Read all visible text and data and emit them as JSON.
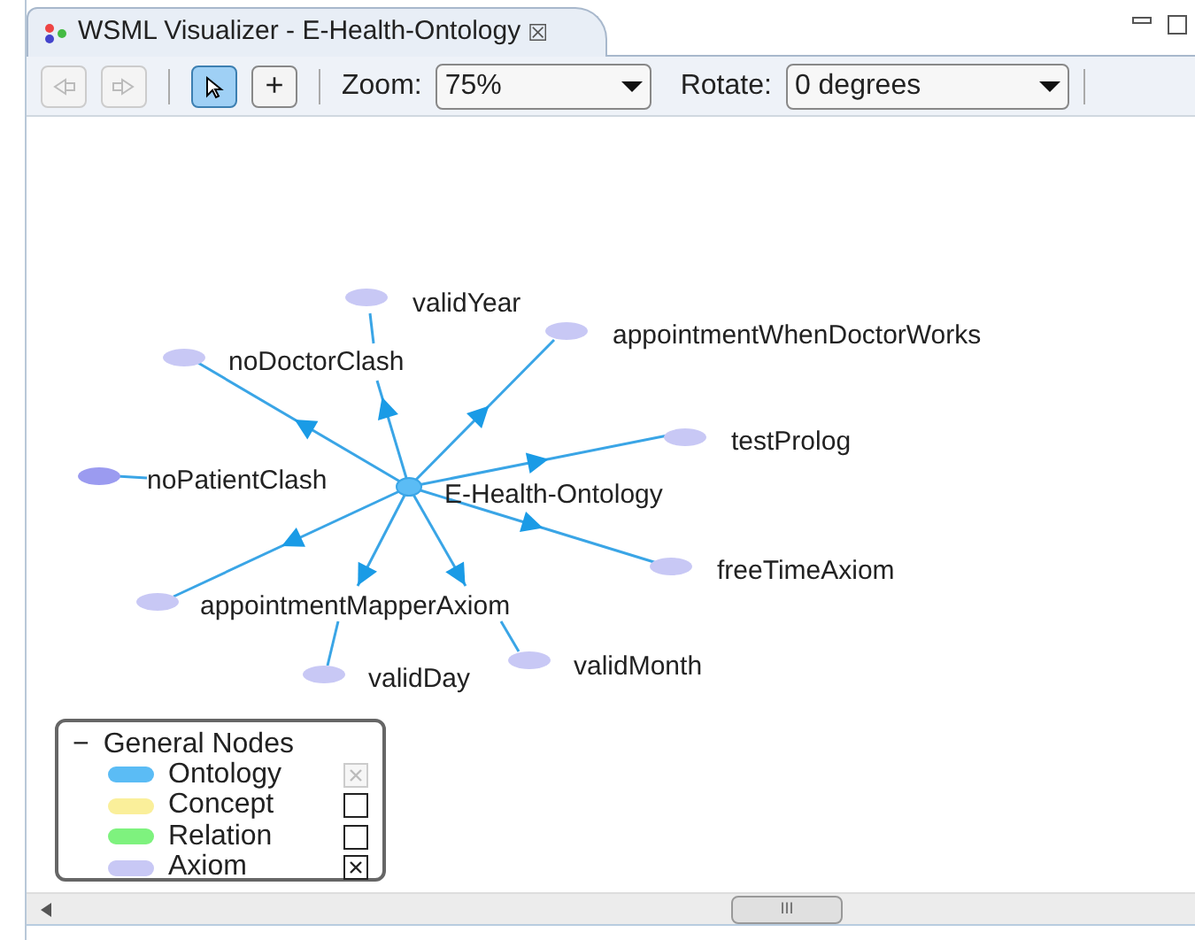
{
  "tab": {
    "title": "WSML Visualizer - E-Health-Ontology",
    "close": "☒"
  },
  "toolbar": {
    "buttons": [
      {
        "kind": "back",
        "disabled": true,
        "selected": false
      },
      {
        "kind": "forward",
        "disabled": true,
        "selected": false
      },
      {
        "kind": "select",
        "disabled": false,
        "selected": true
      },
      {
        "kind": "add",
        "disabled": false,
        "selected": false,
        "label": "+"
      }
    ],
    "zoom": {
      "label": "Zoom:",
      "value": "75%"
    },
    "rotate": {
      "label": "Rotate:",
      "value": "0 degrees"
    }
  },
  "graph": {
    "nodes": [
      {
        "label": "validYear",
        "kind": "axiom"
      },
      {
        "label": "appointmentWhenDoctorWorks",
        "kind": "axiom"
      },
      {
        "label": "noDoctorClash",
        "kind": "axiom"
      },
      {
        "label": "testProlog",
        "kind": "axiom"
      },
      {
        "label": "noPatientClash",
        "kind": "axiom"
      },
      {
        "label": "E-Health-Ontology",
        "kind": "ontology"
      },
      {
        "label": "freeTimeAxiom",
        "kind": "axiom"
      },
      {
        "label": "appointmentMapperAxiom",
        "kind": "axiom"
      },
      {
        "label": "validMonth",
        "kind": "axiom"
      },
      {
        "label": "validDay",
        "kind": "axiom"
      }
    ]
  },
  "legend": {
    "title": "General Nodes",
    "toggle": "−",
    "items": [
      {
        "label": "Ontology",
        "color": "#5bbcf5",
        "checked": true,
        "disabled": true
      },
      {
        "label": "Concept",
        "color": "#faef9a",
        "checked": false,
        "disabled": false
      },
      {
        "label": "Relation",
        "color": "#7ef27e",
        "checked": false,
        "disabled": false
      },
      {
        "label": "Axiom",
        "color": "#c8c8f5",
        "checked": true,
        "disabled": false
      }
    ]
  },
  "scrollbar": {
    "grip": "III"
  }
}
